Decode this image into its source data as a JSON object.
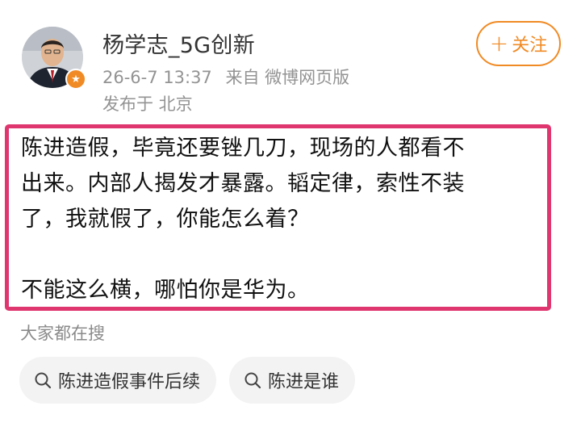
{
  "header": {
    "username": "杨学志_5G创新",
    "timestamp": "26-6-7 13:37",
    "source": "来自 微博网页版",
    "location": "发布于 北京",
    "follow_label": "关注",
    "follow_plus": "+",
    "avatar_icon": "user-avatar-icon",
    "badge_icon": "verified-star-icon",
    "colors": {
      "accent": "#f08a24",
      "meta": "#939393",
      "highlight_border": "#e0366f"
    }
  },
  "post": {
    "lines": [
      "陈进造假，毕竟还要锉几刀，现场的人都看不",
      "出来。内部人揭发才暴露。韬定律，索性不装",
      "了，我就假了，你能怎么着？",
      "",
      " 不能这么横，哪怕你是华为。"
    ]
  },
  "search": {
    "heading": "大家都在搜",
    "chips": [
      {
        "label": "陈进造假事件后续",
        "icon": "search-icon"
      },
      {
        "label": "陈进是谁",
        "icon": "search-icon"
      }
    ]
  }
}
